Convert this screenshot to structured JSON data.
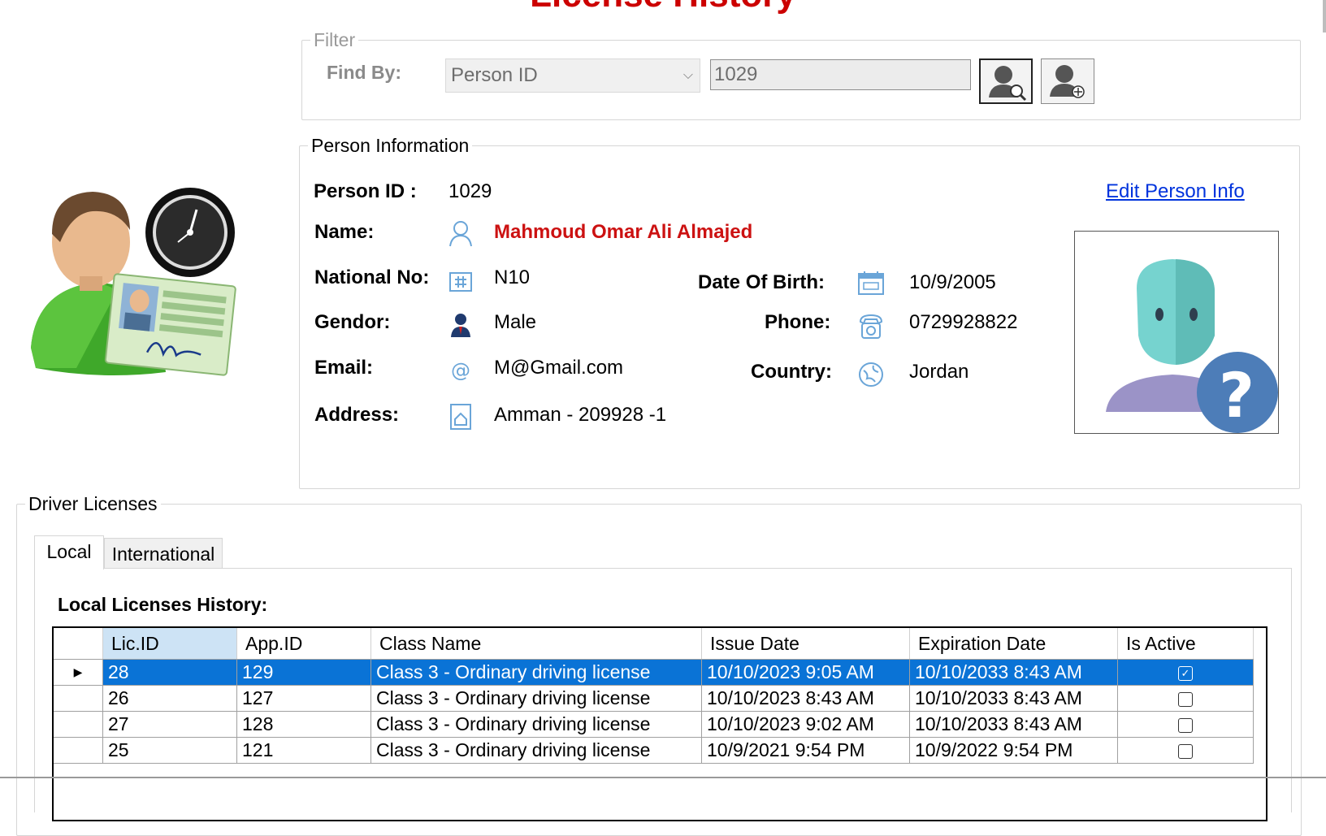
{
  "title": "License History",
  "filter": {
    "legend": "Filter",
    "find_by_label": "Find By:",
    "find_by_value": "Person ID",
    "search_value": "1029"
  },
  "person": {
    "legend": "Person Information",
    "edit_link": "Edit Person Info",
    "labels": {
      "person_id": "Person ID :",
      "name": "Name:",
      "national_no": "National No:",
      "gendor": "Gendor:",
      "email": "Email:",
      "address": "Address:",
      "dob": "Date Of Birth:",
      "phone": "Phone:",
      "country": "Country:"
    },
    "values": {
      "person_id": "1029",
      "name": "Mahmoud Omar Ali Almajed",
      "national_no": "N10",
      "gendor": "Male",
      "email": "M@Gmail.com",
      "address": "Amman - 209928 -1",
      "dob": "10/9/2005",
      "phone": "0729928822",
      "country": "Jordan"
    }
  },
  "licenses": {
    "legend": "Driver Licenses",
    "tabs": [
      "Local",
      "International"
    ],
    "history_label": "Local Licenses History:",
    "columns": [
      "Lic.ID",
      "App.ID",
      "Class Name",
      "Issue Date",
      "Expiration Date",
      "Is Active"
    ],
    "rows": [
      {
        "lic_id": "28",
        "app_id": "129",
        "class_name": "Class 3 - Ordinary driving license",
        "issue_date": "10/10/2023 9:05 AM",
        "expiration_date": "10/10/2033 8:43 AM",
        "is_active": true
      },
      {
        "lic_id": "26",
        "app_id": "127",
        "class_name": "Class 3 - Ordinary driving license",
        "issue_date": "10/10/2023 8:43 AM",
        "expiration_date": "10/10/2033 8:43 AM",
        "is_active": false
      },
      {
        "lic_id": "27",
        "app_id": "128",
        "class_name": "Class 3 - Ordinary driving license",
        "issue_date": "10/10/2023 9:02 AM",
        "expiration_date": "10/10/2033 8:43 AM",
        "is_active": false
      },
      {
        "lic_id": "25",
        "app_id": "121",
        "class_name": "Class 3 - Ordinary driving license",
        "issue_date": "10/9/2021 9:54 PM",
        "expiration_date": "10/9/2022 9:54 PM",
        "is_active": false
      }
    ]
  },
  "colors": {
    "title": "#cc0000",
    "selected_row": "#0a73d6",
    "link": "#0033dd"
  }
}
